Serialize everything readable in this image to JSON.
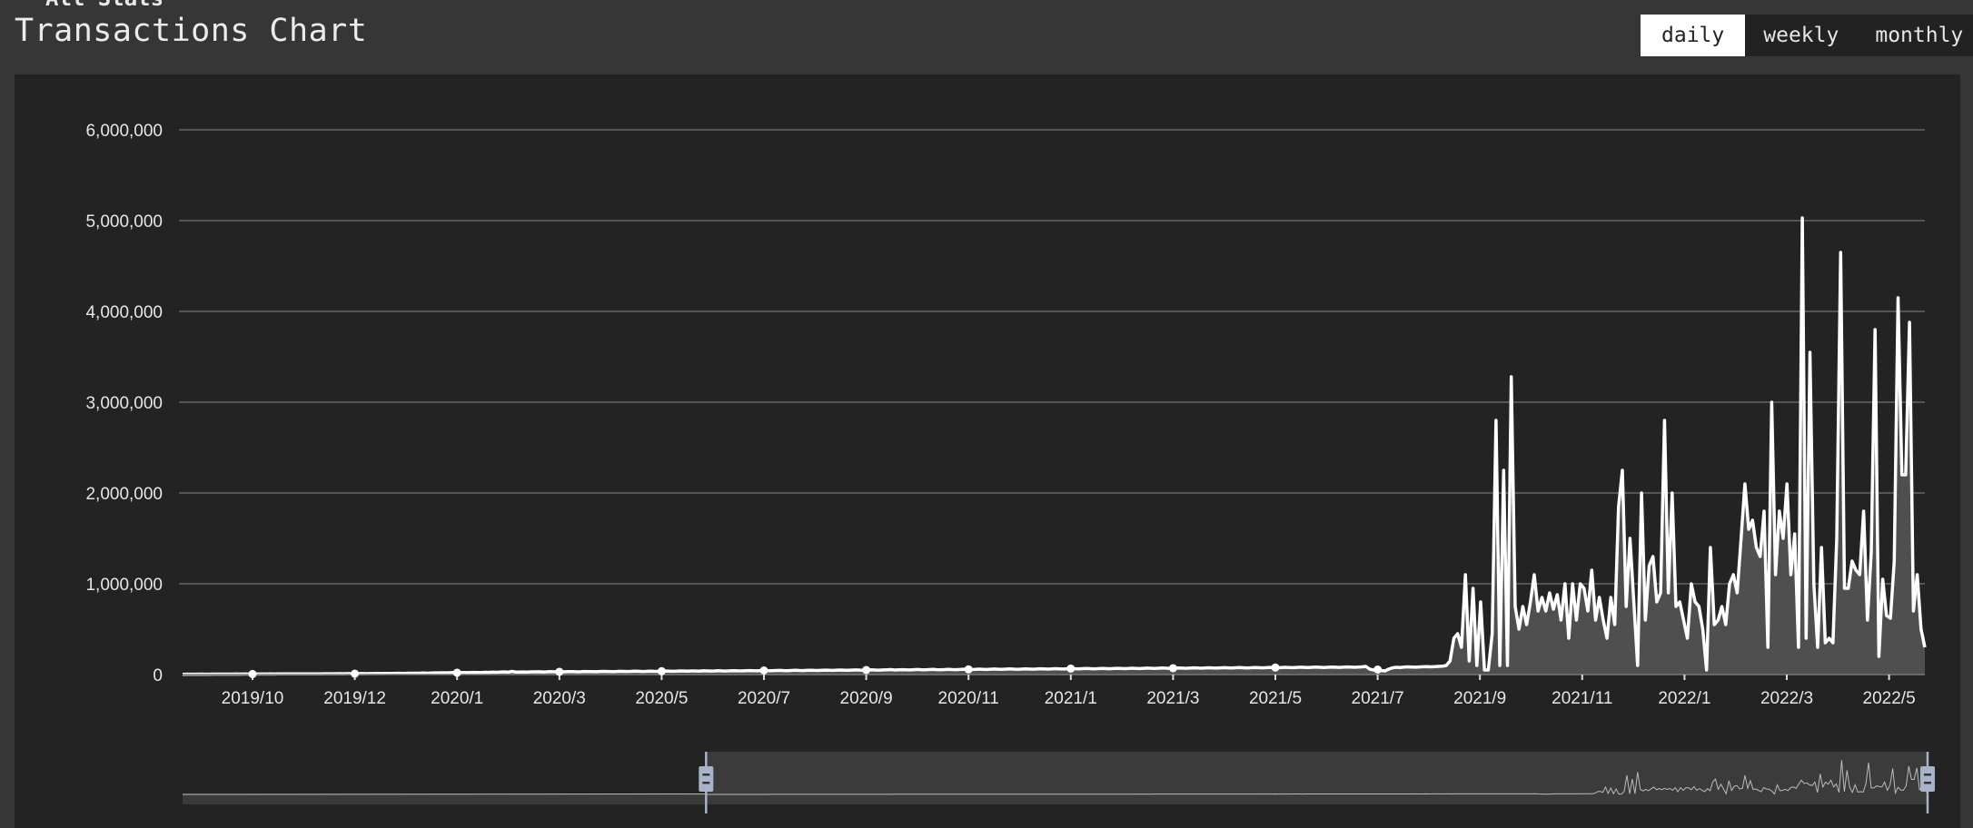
{
  "section": {
    "label": "All Stats"
  },
  "header": {
    "title": "Transactions Chart"
  },
  "range_tabs": [
    {
      "label": "daily",
      "active": true
    },
    {
      "label": "weekly",
      "active": false
    },
    {
      "label": "monthly",
      "active": false
    }
  ],
  "colors": {
    "page_bg": "#363636",
    "panel_bg": "#232323",
    "line": "#ffffff",
    "area": "#4f4f4f",
    "grid": "#666666",
    "slider_handle": "#a9b3c8"
  },
  "chart_data": {
    "type": "area",
    "title": "",
    "xlabel": "",
    "ylabel": "",
    "ylim": [
      0,
      6000000
    ],
    "grid": true,
    "y_ticks": [
      "0",
      "1,000,000",
      "2,000,000",
      "3,000,000",
      "4,000,000",
      "5,000,000",
      "6,000,000"
    ],
    "x_ticks": [
      "2019/10",
      "2019/12",
      "2020/1",
      "2020/3",
      "2020/5",
      "2020/7",
      "2020/9",
      "2020/11",
      "2021/1",
      "2021/3",
      "2021/5",
      "2021/7",
      "2021/9",
      "2021/11",
      "2022/1",
      "2022/3",
      "2022/5"
    ],
    "values": [
      3000,
      3500,
      4000,
      3800,
      4200,
      4500,
      4100,
      4300,
      4800,
      5000,
      5200,
      4900,
      5100,
      5300,
      5600,
      5400,
      5800,
      6000,
      5700,
      6100,
      6300,
      6000,
      6500,
      6800,
      6400,
      6700,
      7000,
      6900,
      7200,
      7500,
      7300,
      7100,
      7600,
      7900,
      8200,
      8000,
      8400,
      8800,
      9000,
      8700,
      9200,
      9500,
      9300,
      9700,
      10000,
      9800,
      10300,
      10800,
      10500,
      11000,
      11500,
      12000,
      11400,
      12500,
      13000,
      12800,
      13500,
      14000,
      13200,
      14500,
      15000,
      14600,
      16000,
      18000,
      15500,
      17000,
      19000,
      18500,
      20000,
      19000,
      21000,
      22000,
      20500,
      23000,
      21500,
      22500,
      24000,
      23000,
      22000,
      25000,
      24000,
      26000,
      25000,
      27000,
      30000,
      26000,
      35000,
      28000,
      27000,
      29000,
      28000,
      30000,
      29500,
      31000,
      28500,
      30000,
      32000,
      31000,
      30500,
      29000,
      31000,
      33000,
      32000,
      30000,
      31500,
      34000,
      33000,
      32500,
      31000,
      33500,
      35000,
      34000,
      32000,
      33000,
      36000,
      34500,
      33500,
      35000,
      37000,
      36000,
      34000,
      35500,
      38000,
      36500,
      35000,
      37500,
      39000,
      38000,
      36000,
      37000,
      39500,
      38500,
      37000,
      40000,
      39000,
      38000,
      41000,
      40000,
      38500,
      39500,
      42000,
      40500,
      39000,
      41500,
      43000,
      41000,
      40000,
      42500,
      44000,
      42000,
      41000,
      43500,
      45000,
      43000,
      42000,
      44500,
      46000,
      44000,
      43000,
      45500,
      47000,
      45000,
      44000,
      46500,
      48000,
      46000,
      45000,
      47500,
      49000,
      47000,
      46000,
      48500,
      50000,
      48000,
      47000,
      49500,
      51000,
      49000,
      48000,
      50500,
      52000,
      50000,
      49000,
      51500,
      53000,
      55000,
      50000,
      52500,
      54000,
      52000,
      51000,
      53500,
      56000,
      53000,
      52000,
      54500,
      57000,
      54000,
      53000,
      55500,
      58000,
      55000,
      54000,
      56500,
      59000,
      57000,
      55000,
      57500,
      60000,
      58000,
      56000,
      58500,
      61000,
      59000,
      57000,
      59500,
      62000,
      60000,
      58000,
      60500,
      63000,
      61000,
      59000,
      61500,
      64000,
      62000,
      60000,
      62500,
      65000,
      63000,
      61000,
      63500,
      66000,
      64000,
      62000,
      64500,
      67000,
      65000,
      63000,
      65500,
      68000,
      66000,
      64000,
      66500,
      69000,
      67000,
      65000,
      67500,
      70000,
      68000,
      66000,
      68500,
      71000,
      69000,
      67000,
      69500,
      72000,
      70000,
      68000,
      70500,
      73000,
      71000,
      69000,
      71500,
      74000,
      72000,
      70000,
      72500,
      75000,
      73000,
      71000,
      73500,
      76000,
      74000,
      72000,
      74500,
      77000,
      75000,
      73000,
      75500,
      78000,
      76000,
      74000,
      76500,
      79000,
      77000,
      75000,
      77500,
      80000,
      78000,
      76000,
      78500,
      81000,
      79000,
      77000,
      79500,
      82000,
      80000,
      78000,
      80500,
      83000,
      81000,
      79000,
      81500,
      84000,
      82000,
      80000,
      82500,
      85000,
      90000,
      60000,
      50000,
      55000,
      45000,
      40000,
      60000,
      75000,
      80000,
      78000,
      82000,
      85000,
      83000,
      81000,
      84000,
      86000,
      88000,
      85000,
      87000,
      90000,
      92000,
      100000,
      150000,
      400000,
      450000,
      300000,
      1100000,
      150000,
      950000,
      100000,
      800000,
      50000,
      50000,
      450000,
      2800000,
      100000,
      2250000,
      100000,
      3280000,
      750000,
      500000,
      750000,
      550000,
      800000,
      1100000,
      700000,
      850000,
      700000,
      900000,
      720000,
      880000,
      600000,
      1000000,
      400000,
      1000000,
      600000,
      1000000,
      950000,
      700000,
      1150000,
      600000,
      850000,
      600000,
      400000,
      850000,
      550000,
      1850000,
      2250000,
      750000,
      1500000,
      800000,
      100000,
      2000000,
      600000,
      1200000,
      1300000,
      800000,
      900000,
      2800000,
      900000,
      2000000,
      750000,
      800000,
      600000,
      400000,
      1000000,
      800000,
      750000,
      500000,
      50000,
      1400000,
      550000,
      600000,
      750000,
      550000,
      1000000,
      1100000,
      900000,
      1500000,
      2100000,
      1600000,
      1700000,
      1400000,
      1300000,
      1800000,
      300000,
      3000000,
      1100000,
      1800000,
      1500000,
      2100000,
      1100000,
      1550000,
      300000,
      5030000,
      400000,
      3550000,
      1000000,
      300000,
      1400000,
      350000,
      400000,
      350000,
      1500000,
      4650000,
      950000,
      950000,
      1250000,
      1150000,
      1100000,
      1800000,
      600000,
      1350000,
      3800000,
      200000,
      1050000,
      650000,
      620000,
      1250000,
      4150000,
      2200000,
      2200000,
      3880000,
      700000,
      1100000,
      500000,
      300000
    ],
    "slider": {
      "range_start_percent": 30,
      "range_end_percent": 100
    }
  }
}
